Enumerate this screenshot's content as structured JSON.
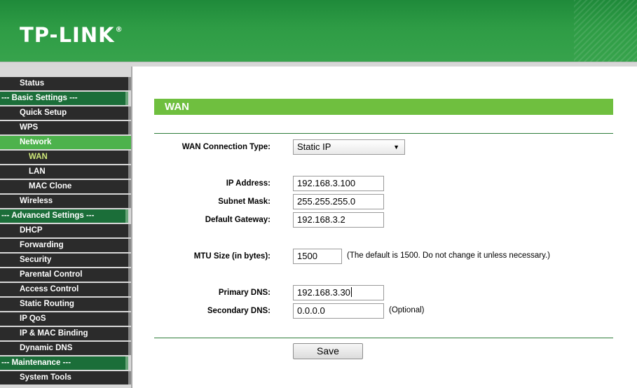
{
  "header": {
    "brand": "TP-LINK",
    "registered": "®"
  },
  "sidebar": {
    "items": [
      {
        "label": "Status",
        "kind": "item"
      },
      {
        "label": "--- Basic Settings ---",
        "kind": "group"
      },
      {
        "label": "Quick Setup",
        "kind": "item"
      },
      {
        "label": "WPS",
        "kind": "item"
      },
      {
        "label": "Network",
        "kind": "active"
      },
      {
        "label": "WAN",
        "kind": "current"
      },
      {
        "label": "LAN",
        "kind": "sub"
      },
      {
        "label": "MAC Clone",
        "kind": "sub"
      },
      {
        "label": "Wireless",
        "kind": "item"
      },
      {
        "label": "--- Advanced Settings ---",
        "kind": "group"
      },
      {
        "label": "DHCP",
        "kind": "item"
      },
      {
        "label": "Forwarding",
        "kind": "item"
      },
      {
        "label": "Security",
        "kind": "item"
      },
      {
        "label": "Parental Control",
        "kind": "item"
      },
      {
        "label": "Access Control",
        "kind": "item"
      },
      {
        "label": "Static Routing",
        "kind": "item"
      },
      {
        "label": "IP QoS",
        "kind": "item"
      },
      {
        "label": "IP & MAC Binding",
        "kind": "item"
      },
      {
        "label": "Dynamic DNS",
        "kind": "item"
      },
      {
        "label": "--- Maintenance ---",
        "kind": "group"
      },
      {
        "label": "System Tools",
        "kind": "item"
      }
    ]
  },
  "page": {
    "title": "WAN"
  },
  "form": {
    "connection_type_label": "WAN Connection Type:",
    "connection_type_value": "Static IP",
    "dropdown_arrow": "▼",
    "ip_label": "IP Address:",
    "ip_value": "192.168.3.100",
    "subnet_label": "Subnet Mask:",
    "subnet_value": "255.255.255.0",
    "gateway_label": "Default Gateway:",
    "gateway_value": "192.168.3.2",
    "mtu_label": "MTU Size (in bytes):",
    "mtu_value": "1500",
    "mtu_hint": "(The default is 1500. Do not change it unless necessary.)",
    "dns1_label": "Primary DNS:",
    "dns1_value": "192.168.3.30",
    "dns2_label": "Secondary DNS:",
    "dns2_value": "0.0.0.0",
    "dns2_hint": "(Optional)",
    "save_label": "Save"
  },
  "colors": {
    "header_green": "#2e9c45",
    "title_green": "#6fbf3f",
    "group_green": "#1b6e39",
    "menu_dark": "#2b2b2b",
    "active_green": "#4db24c"
  }
}
